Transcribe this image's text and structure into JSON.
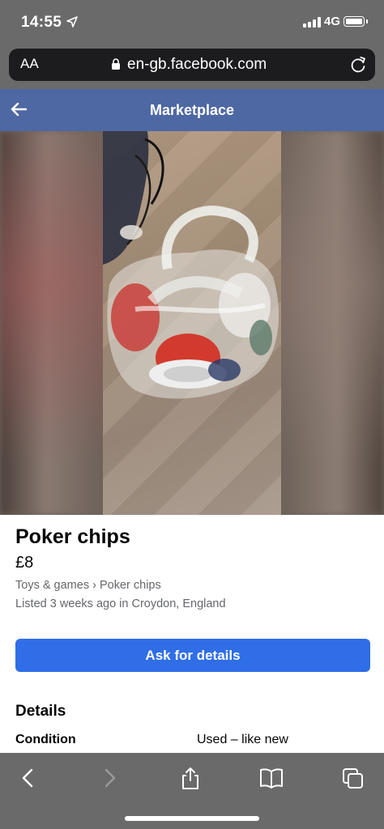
{
  "status_bar": {
    "time": "14:55",
    "network": "4G",
    "icons": [
      "location-arrow-icon",
      "signal-bars-icon",
      "battery-icon"
    ]
  },
  "browser": {
    "text_size_label": "AA",
    "url": "en-gb.facebook.com",
    "icons": [
      "lock-icon",
      "reload-icon"
    ]
  },
  "header": {
    "title": "Marketplace",
    "back_icon": "back-arrow-icon",
    "background_color": "#4d68a3"
  },
  "listing": {
    "title": "Poker chips",
    "price": "£8",
    "category": "Toys & games",
    "breadcrumb_separator": "›",
    "subcategory": "Poker chips",
    "listed_text": "Listed 3 weeks ago in Croydon, England",
    "ask_button_label": "Ask for details",
    "ask_button_color": "#2f6ee6",
    "details_heading": "Details",
    "condition_label": "Condition",
    "condition_value": "Used – like new"
  },
  "toolbar": {
    "icons": [
      "back-icon",
      "forward-icon",
      "share-icon",
      "bookmarks-icon",
      "tabs-icon"
    ]
  }
}
